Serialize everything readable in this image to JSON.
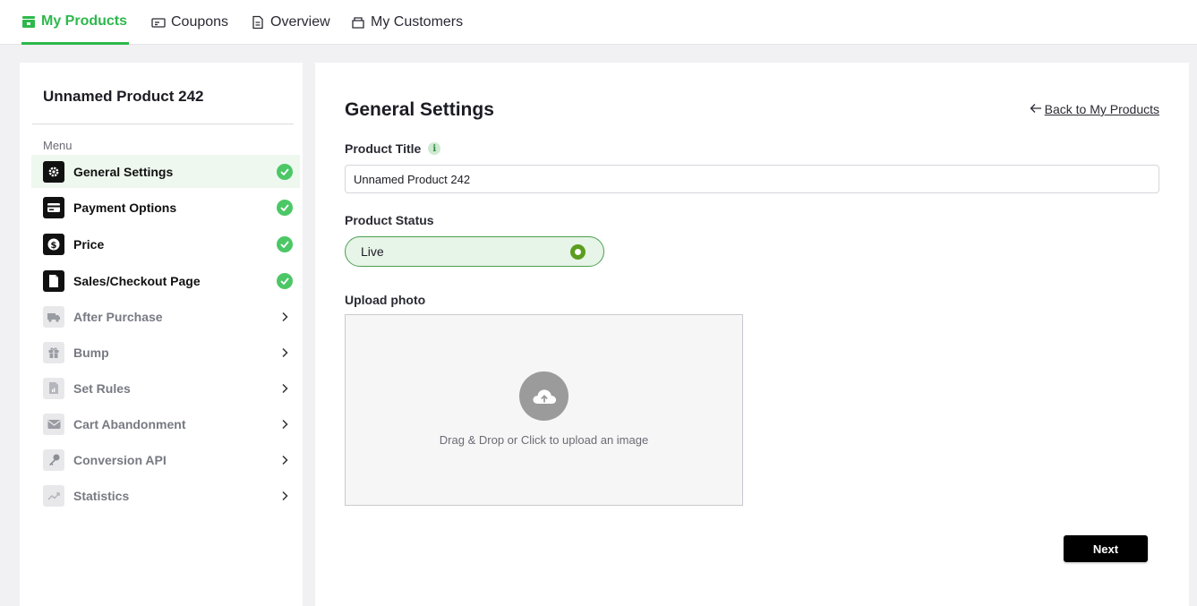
{
  "topnav": {
    "tabs": [
      {
        "label": "My Products",
        "icon": "store-icon",
        "active": true
      },
      {
        "label": "Coupons",
        "icon": "coupon-icon",
        "active": false
      },
      {
        "label": "Overview",
        "icon": "document-icon",
        "active": false
      },
      {
        "label": "My Customers",
        "icon": "customers-icon",
        "active": false
      }
    ]
  },
  "sidebar": {
    "product_name": "Unnamed Product 242",
    "menu_label": "Menu",
    "items": [
      {
        "label": "General Settings",
        "icon": "gear-icon",
        "status": "complete",
        "selected": true
      },
      {
        "label": "Payment Options",
        "icon": "credit-card-icon",
        "status": "complete"
      },
      {
        "label": "Price",
        "icon": "dollar-icon",
        "status": "complete"
      },
      {
        "label": "Sales/Checkout Page",
        "icon": "page-icon",
        "status": "complete"
      },
      {
        "label": "After Purchase",
        "icon": "truck-icon",
        "status": "pending"
      },
      {
        "label": "Bump",
        "icon": "gift-icon",
        "status": "pending"
      },
      {
        "label": "Set Rules",
        "icon": "rules-doc-icon",
        "status": "pending"
      },
      {
        "label": "Cart Abandonment",
        "icon": "mail-icon",
        "status": "pending"
      },
      {
        "label": "Conversion API",
        "icon": "key-icon",
        "status": "pending"
      },
      {
        "label": "Statistics",
        "icon": "trend-icon",
        "status": "pending"
      }
    ]
  },
  "main": {
    "title": "General Settings",
    "back_link": "Back to My Products",
    "product_title_label": "Product Title",
    "product_title_value": "Unnamed Product 242",
    "product_status_label": "Product Status",
    "product_status_value": "Live",
    "upload_label": "Upload photo",
    "upload_text": "Drag & Drop or Click to upload an image",
    "next_label": "Next"
  },
  "colors": {
    "accent": "#2db84c",
    "check": "#4cc766",
    "status_bg": "#e7f4e8",
    "status_border": "#4aa04f",
    "radio": "#5a9e1f"
  }
}
